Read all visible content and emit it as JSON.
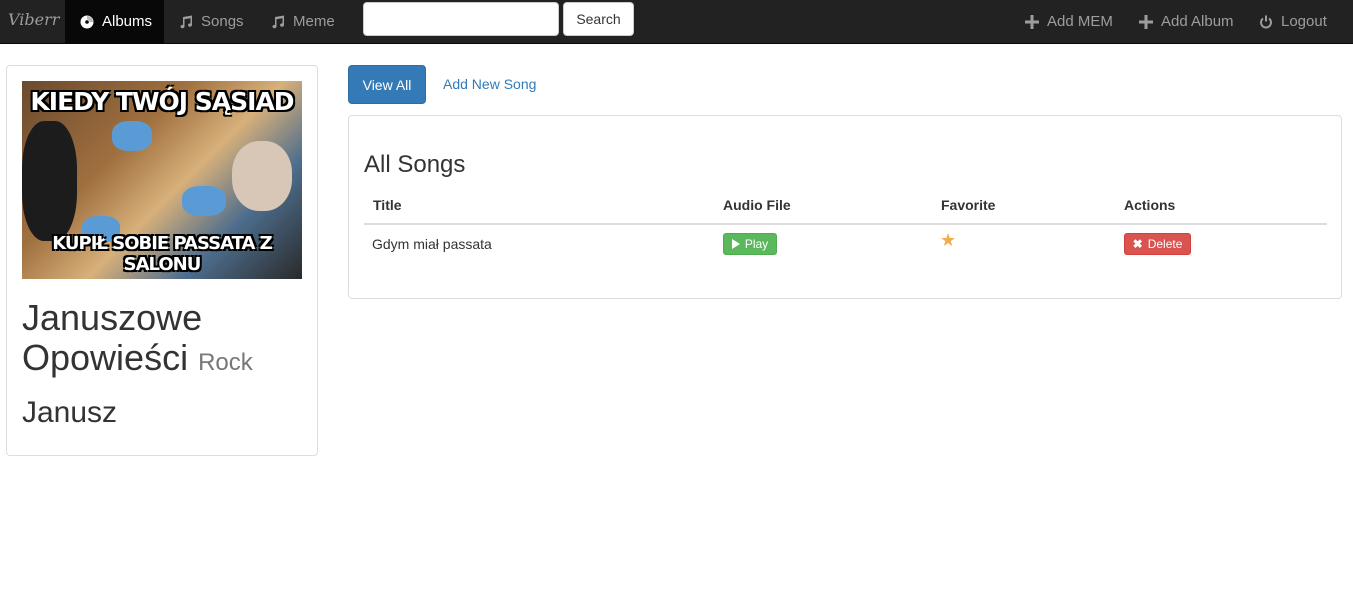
{
  "navbar": {
    "brand": "Viberr",
    "items": [
      {
        "label": "Albums",
        "icon": "cd-icon",
        "active": true
      },
      {
        "label": "Songs",
        "icon": "music-note-icon",
        "active": false
      },
      {
        "label": "Meme",
        "icon": "music-note-icon",
        "active": false
      }
    ],
    "search_button": "Search",
    "right_items": [
      {
        "label": "Add MEM",
        "icon": "plus-icon"
      },
      {
        "label": "Add Album",
        "icon": "plus-icon"
      },
      {
        "label": "Logout",
        "icon": "power-icon"
      }
    ]
  },
  "album": {
    "cover_top_text": "KIEDY TWÓJ SĄSIAD",
    "cover_bottom_text": "KUPIŁ SOBIE PASSATA Z SALONU",
    "title": "Januszowe Opowieści",
    "genre": "Rock",
    "artist": "Janusz"
  },
  "actions": {
    "view_all": "View All",
    "add_new_song": "Add New Song"
  },
  "songs": {
    "heading": "All Songs",
    "columns": [
      "Title",
      "Audio File",
      "Favorite",
      "Actions"
    ],
    "rows": [
      {
        "title": "Gdym miał passata",
        "play_label": "Play",
        "favorite": true,
        "delete_label": "Delete"
      }
    ]
  },
  "colors": {
    "navbar_bg": "#222222",
    "primary": "#337ab7",
    "success": "#5cb85c",
    "danger": "#d9534f",
    "star": "#f0ad4e"
  }
}
